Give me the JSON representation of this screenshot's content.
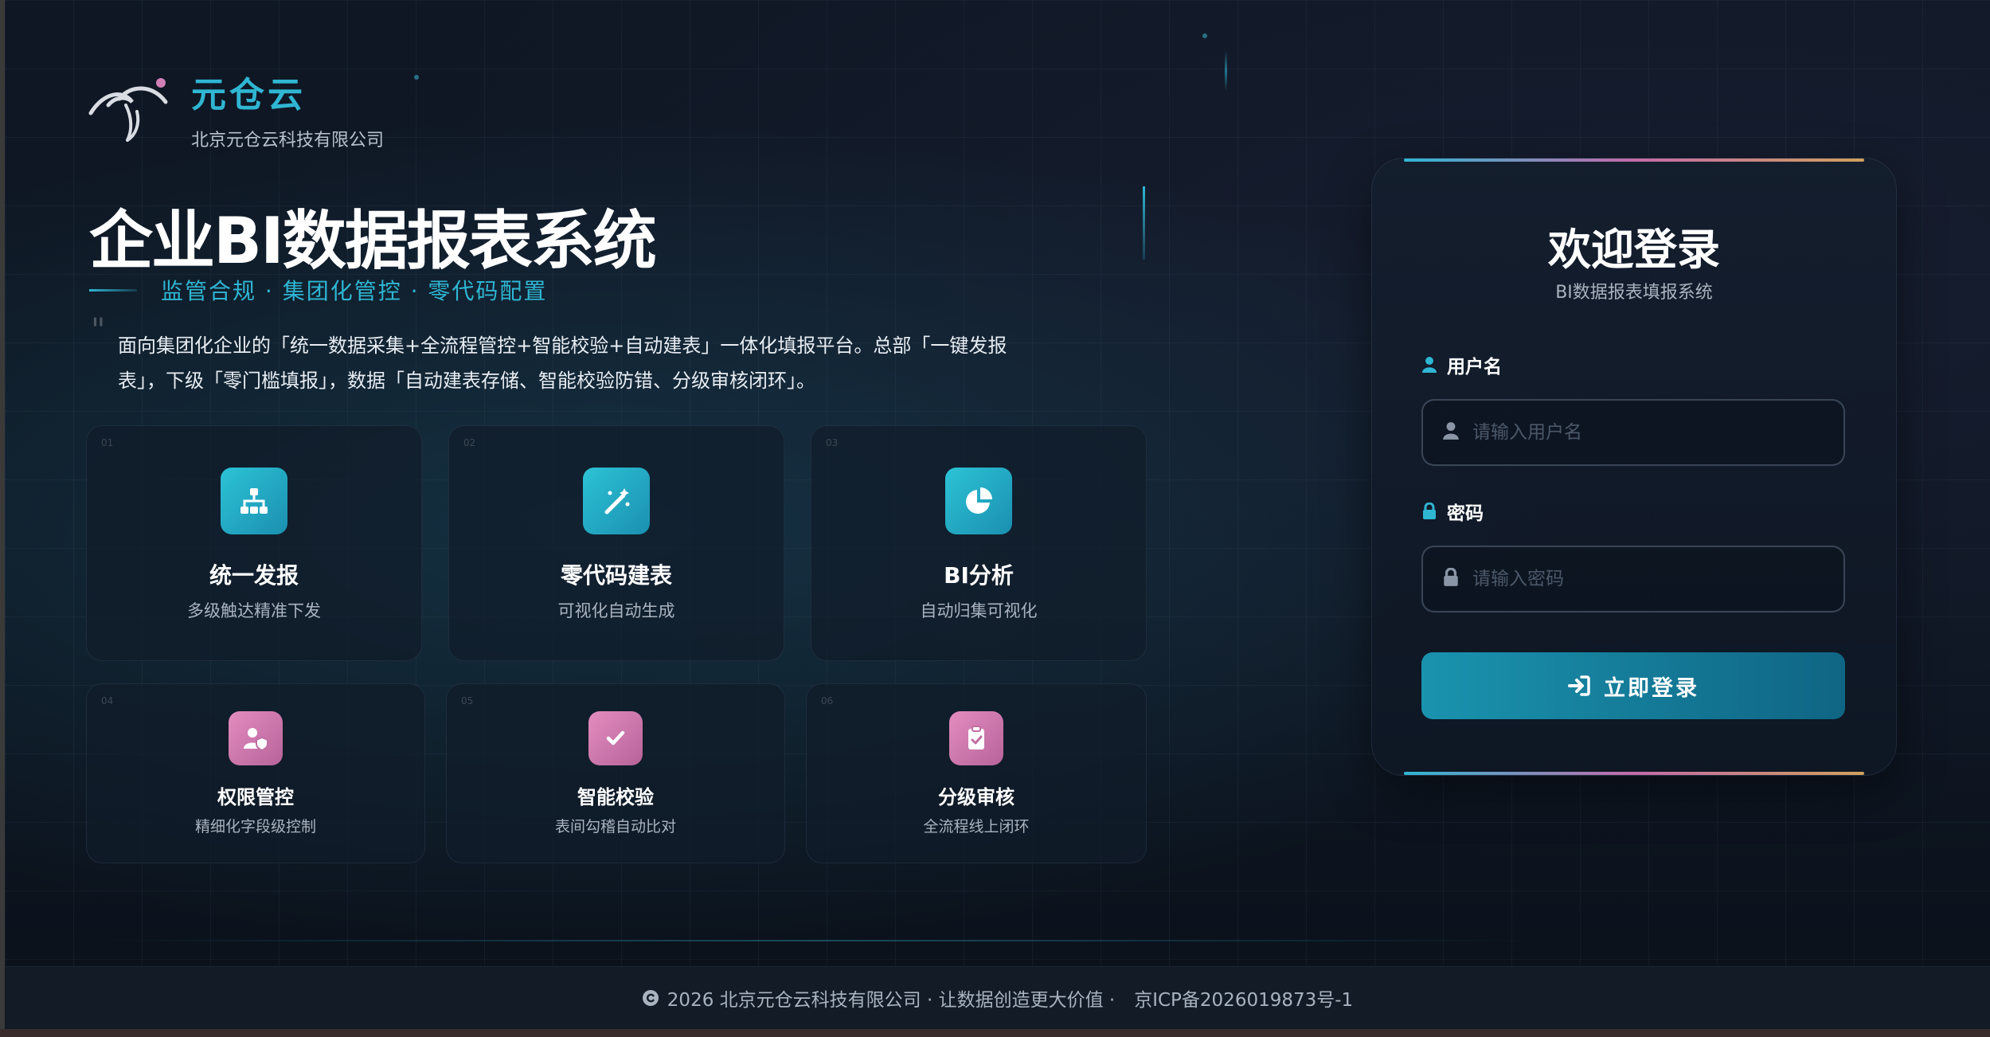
{
  "brand": {
    "name": "元仓云",
    "company": "北京元仓云科技有限公司"
  },
  "hero": {
    "title": "企业BI数据报表系统",
    "subtitle": "监管合规 · 集团化管控 · 零代码配置",
    "intro": "面向集团化企业的「统一数据采集+全流程管控+智能校验+自动建表」一体化填报平台。总部「一键发报表」，下级「零门槛填报」，数据「自动建表存储、智能校验防错、分级审核闭环」。"
  },
  "features": [
    {
      "num": "01",
      "title": "统一发报",
      "desc": "多级触达精准下发",
      "icon": "org-chart-icon",
      "color": "teal"
    },
    {
      "num": "02",
      "title": "零代码建表",
      "desc": "可视化自动生成",
      "icon": "magic-wand-icon",
      "color": "teal"
    },
    {
      "num": "03",
      "title": "BI分析",
      "desc": "自动归集可视化",
      "icon": "pie-chart-icon",
      "color": "teal"
    },
    {
      "num": "04",
      "title": "权限管控",
      "desc": "精细化字段级控制",
      "icon": "user-shield-icon",
      "color": "pink"
    },
    {
      "num": "05",
      "title": "智能校验",
      "desc": "表间勾稽自动比对",
      "icon": "check-icon",
      "color": "pink"
    },
    {
      "num": "06",
      "title": "分级审核",
      "desc": "全流程线上闭环",
      "icon": "clipboard-check-icon",
      "color": "pink"
    }
  ],
  "login": {
    "title": "欢迎登录",
    "subtitle": "BI数据报表填报系统",
    "username_label": "用户名",
    "username_placeholder": "请输入用户名",
    "password_label": "密码",
    "password_placeholder": "请输入密码",
    "submit_label": "立即登录"
  },
  "footer": {
    "copyright": "2026 北京元仓云科技有限公司 · 让数据创造更大价值 ·",
    "icp": "京ICP备2026019873号-1"
  },
  "colors": {
    "accent": "#2fb6d3",
    "pink": "#c56aa9",
    "background": "#0e1622"
  }
}
